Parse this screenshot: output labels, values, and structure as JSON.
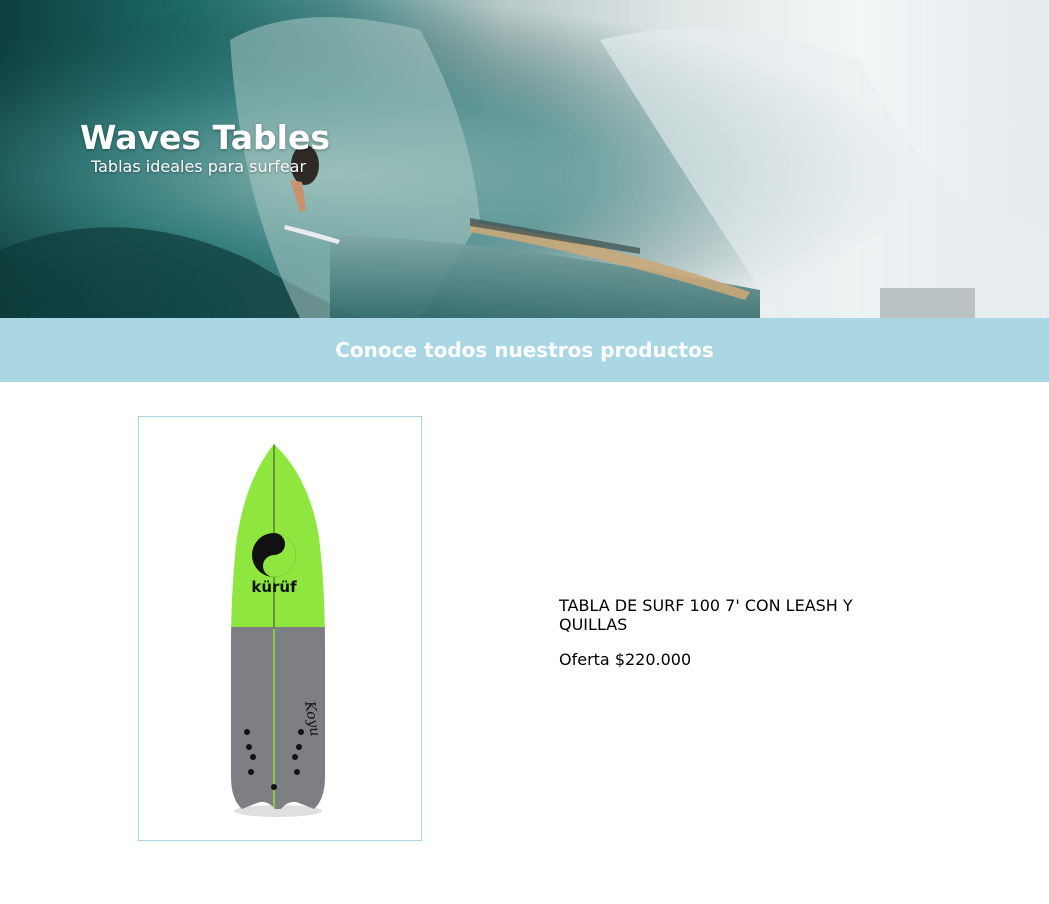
{
  "hero": {
    "title": "Waves Tables",
    "subtitle": "Tablas ideales para surfear"
  },
  "banner": {
    "text": "Conoce todos nuestros productos",
    "background_color": "#abd7e5"
  },
  "product": {
    "name": "TABLA DE SURF 100 7' CON LEASH Y QUILLAS",
    "price": "Oferta $220.000",
    "image": {
      "top_color": "#8ee63f",
      "bottom_color": "#7d7f85",
      "logo_text": "kürüf",
      "signature_text": "Koyu"
    }
  }
}
